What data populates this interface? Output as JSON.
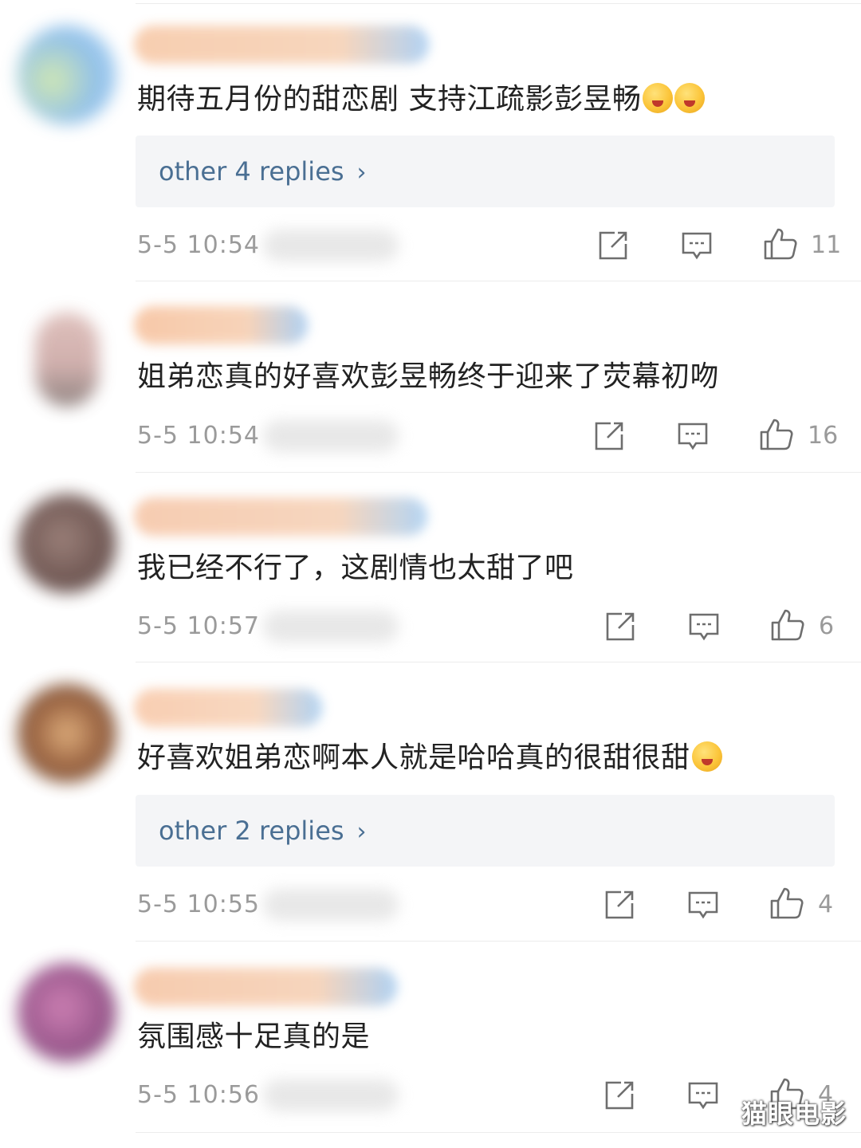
{
  "comments": [
    {
      "text": "期待五月份的甜恋剧 支持江疏影彭昱畅",
      "emoji": "😳😳",
      "emoji_names": [
        "flushed-face-icon",
        "flushed-face-icon"
      ],
      "replies_label": "other 4 replies",
      "timestamp": "5-5 10:54",
      "likes": "11",
      "avatar_color": "#7fb6e6",
      "avatar_accent": "#c9e4a6",
      "username_color_a": "#f7c9a8",
      "username_color_b": "#a8cdf2"
    },
    {
      "text": "姐弟恋真的好喜欢彭昱畅终于迎来了荧幕初吻",
      "emoji": "",
      "replies_label": "",
      "timestamp": "5-5 10:54",
      "likes": "16",
      "avatar_color": "#c9a3a0",
      "avatar_accent": "#7d6e6b",
      "username_color_a": "#f7c3a0",
      "username_color_b": "#a6cbf0"
    },
    {
      "text": "我已经不行了，这剧情也太甜了吧",
      "emoji": "",
      "replies_label": "",
      "timestamp": "5-5 10:57",
      "likes": "6",
      "avatar_color": "#5a3d38",
      "avatar_accent": "#8a6b63",
      "username_color_a": "#f6c7a9",
      "username_color_b": "#abd0f2"
    },
    {
      "text": "好喜欢姐弟恋啊本人就是哈哈真的很甜很甜",
      "emoji": "😛",
      "emoji_names": [
        "tongue-face-icon"
      ],
      "replies_label": "other 2 replies",
      "timestamp": "5-5 10:55",
      "likes": "4",
      "avatar_color": "#6b3a1e",
      "avatar_accent": "#d9a066",
      "username_color_a": "#f8c9aa",
      "username_color_b": "#a9cef1"
    },
    {
      "text": "氛围感十足真的是",
      "emoji": "",
      "replies_label": "",
      "timestamp": "5-5 10:56",
      "likes": "4",
      "avatar_color": "#8a3c7a",
      "avatar_accent": "#c46aa6",
      "username_color_a": "#f6c6a6",
      "username_color_b": "#a7ccf0"
    }
  ],
  "icons": {
    "share": "share-icon",
    "comment": "comment-icon",
    "like": "thumbs-up-icon"
  },
  "watermark": "猫眼电影",
  "colors": {
    "text": "#222222",
    "meta": "#9a9a9a",
    "link": "#4a6f93",
    "reply_bg": "#f4f5f7",
    "divider": "#ececec"
  }
}
